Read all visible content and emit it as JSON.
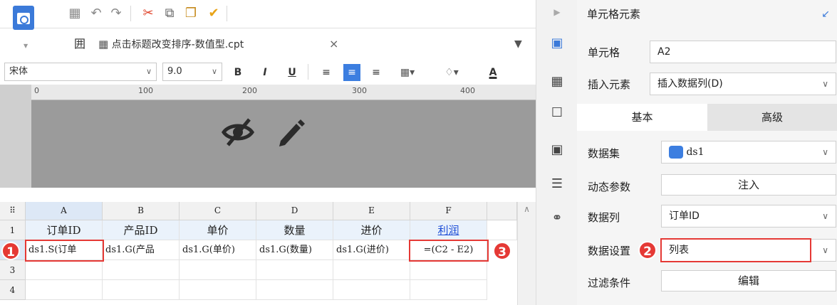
{
  "toolbar": {
    "icons": [
      "save-icon",
      "undo-icon",
      "redo-icon",
      "cut-icon",
      "copy-icon",
      "paste-icon",
      "format-painter-icon"
    ]
  },
  "tab": {
    "grid_glyph": "囲",
    "title": "点击标题改变排序-数值型.cpt",
    "close": "×"
  },
  "format": {
    "font": "宋体",
    "size": "9.0",
    "bold": "B",
    "italic": "I",
    "underline": "U",
    "text_color_glyph": "A"
  },
  "ruler": {
    "marks": [
      "0",
      "100",
      "200",
      "300",
      "400"
    ]
  },
  "grid": {
    "corner": "⠿",
    "columns": [
      "A",
      "B",
      "C",
      "D",
      "E",
      "F"
    ],
    "rows": [
      "1",
      "2",
      "3",
      "4"
    ],
    "row1": [
      "订单ID",
      "产品ID",
      "单价",
      "数量",
      "进价",
      "利润"
    ],
    "row2": [
      "ds1.S(订单",
      "ds1.G(产品",
      "ds1.G(单价)",
      "ds1.G(数量)",
      "ds1.G(进价)",
      "=(C2 - E2)"
    ]
  },
  "markers": [
    "1",
    "2",
    "3"
  ],
  "panel": {
    "title": "单元格元素",
    "cell_label": "单元格",
    "cell_value": "A2",
    "insert_label": "插入元素",
    "insert_value": "插入数据列(D)",
    "tab_basic": "基本",
    "tab_advanced": "高级",
    "dataset_label": "数据集",
    "dataset_value": "ds1",
    "param_label": "动态参数",
    "param_button": "注入",
    "column_label": "数据列",
    "column_value": "订单ID",
    "setting_label": "数据设置",
    "setting_value": "列表",
    "filter_label": "过滤条件",
    "filter_button": "编辑"
  },
  "colors": {
    "accent": "#3c7ee0",
    "marker": "#e53935",
    "canvas": "#9b9b9b",
    "header_row": "#eaf2fb"
  }
}
